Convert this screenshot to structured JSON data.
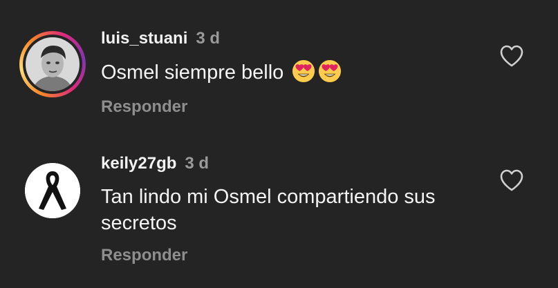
{
  "comments": [
    {
      "username": "luis_stuani",
      "time": "3 d",
      "text": "Osmel siempre bello",
      "emojis": [
        "heart-eyes-emoji",
        "heart-eyes-emoji"
      ],
      "reply_label": "Responder",
      "has_story_ring": true,
      "icons": {
        "like": "heart-outline-icon"
      }
    },
    {
      "username": "keily27gb",
      "time": "3 d",
      "text": "Tan lindo mi Osmel compartiendo sus secretos",
      "reply_label": "Responder",
      "has_story_ring": false,
      "icons": {
        "like": "heart-outline-icon"
      }
    }
  ],
  "colors": {
    "background": "#242424",
    "username": "#f2f2f2",
    "muted": "#9a9a9a"
  }
}
